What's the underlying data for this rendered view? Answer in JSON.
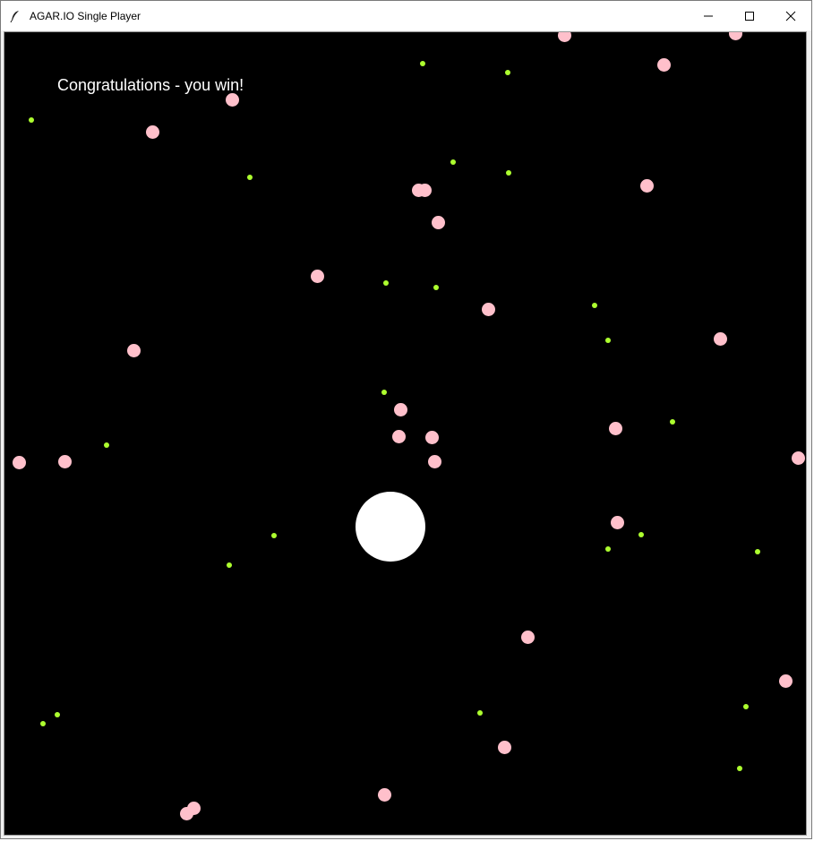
{
  "window": {
    "title": "AGAR.IO Single Player",
    "icon": "feather-icon",
    "controls": [
      "minimize-icon",
      "maximize-icon",
      "close-icon"
    ]
  },
  "game": {
    "status_message": "Congratulations - you win!",
    "colors": {
      "background": "#000000",
      "player": "#ffffff",
      "food": "#adff2f",
      "enemy": "#ffc0cb",
      "text": "#ffffff"
    }
  }
}
